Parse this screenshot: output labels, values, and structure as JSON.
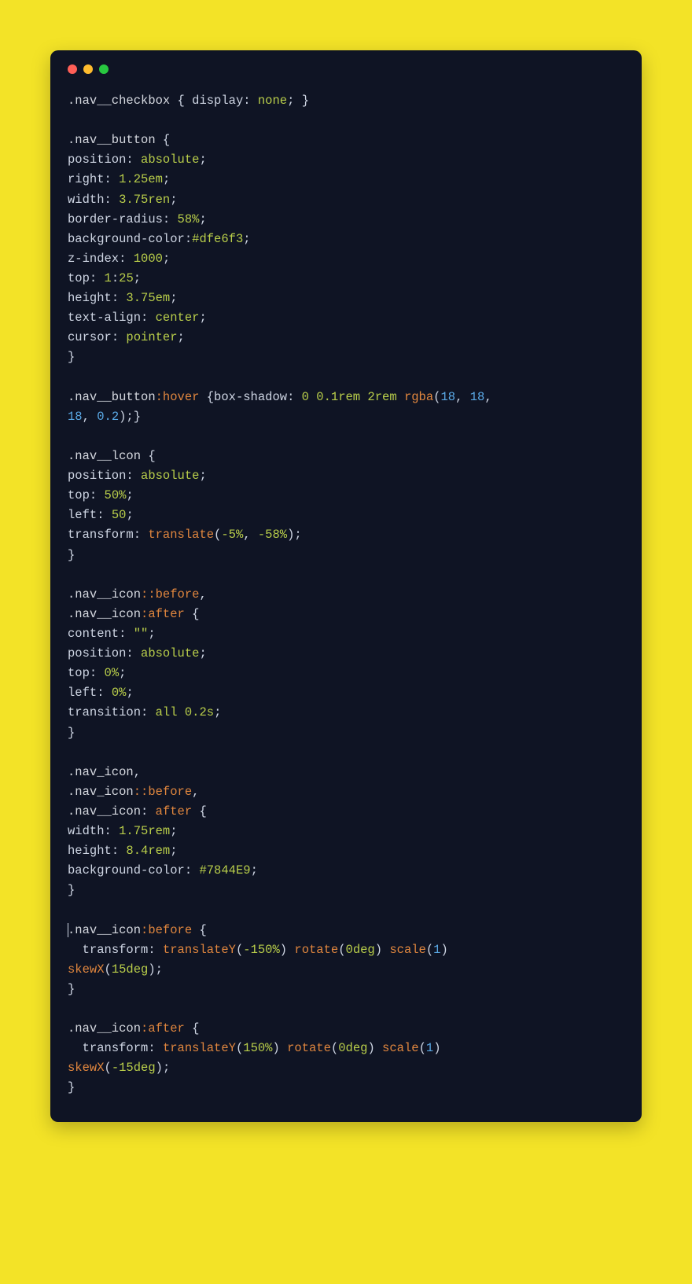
{
  "colors": {
    "close": "#ff5f57",
    "minimize": "#febc2e",
    "zoom": "#28c840"
  },
  "code": {
    "l1_sel": ".nav__checkbox",
    "l1_open": " { ",
    "l1_prop": "display",
    "l1_colon": ": ",
    "l1_val": "none",
    "l1_close": "; }",
    "l3_sel": ".nav__button",
    "l3_open": " {",
    "l4_prop": "position",
    "l4_val": "absolute",
    "l5_prop": "right",
    "l5_val": "1.25em",
    "l6_prop": "width",
    "l6_val": "3.75ren",
    "l7_prop": "border-radius",
    "l7_val": "58%",
    "l8_prop": "background-color",
    "l8_val": "#dfe6f3",
    "l9_prop": "z-index",
    "l9_val": "1000",
    "l10_prop": "top",
    "l10_val": "1",
    "l10_colon2": ":",
    "l10_val2": "25",
    "l11_prop": "height",
    "l11_val": "3.75em",
    "l12_prop": "text-align",
    "l12_val": "center",
    "l13_prop": "cursor",
    "l13_val": "pointer",
    "l14_close": "}",
    "l16_sel": ".nav__button",
    "l16_pseudo": ":hover",
    "l16_open": " {",
    "l16_prop": "box-shadow",
    "l16_colon": ": ",
    "l16_v1": "0",
    "l16_sp1": " ",
    "l16_v2": "0.1rem",
    "l16_sp2": " ",
    "l16_v3": "2rem",
    "l16_sp3": " ",
    "l16_func": "rgba",
    "l16_paren": "(",
    "l16_n1": "18",
    "l16_c1": ", ",
    "l16_n2": "18",
    "l16_c2": ",",
    "l17_n3": "18",
    "l17_c3": ", ",
    "l17_n4": "0.2",
    "l17_close": ");}",
    "l19_sel": ".nav__lcon",
    "l19_open": " {",
    "l20_prop": "position",
    "l20_val": "absolute",
    "l21_prop": "top",
    "l21_val": "50%",
    "l22_prop": "left",
    "l22_val": "50",
    "l23_prop": "transform",
    "l23_colon": ": ",
    "l23_func": "translate",
    "l23_paren": "(",
    "l23_a1": "-5%",
    "l23_c": ", ",
    "l23_a2": "-58%",
    "l23_close": ");",
    "l24_close": "}",
    "l26_sel": ".nav__icon",
    "l26_pseudo": "::before",
    "l26_comma": ",",
    "l27_sel": ".nav__icon",
    "l27_pseudo": ":after",
    "l27_open": " {",
    "l28_prop": "content",
    "l28_val": "\"\"",
    "l29_prop": "position",
    "l29_val": "absolute",
    "l30_prop": "top",
    "l30_val": "0%",
    "l31_prop": "left",
    "l31_val": "0%",
    "l32_prop": "transition",
    "l32_val1": "all",
    "l32_sp": " ",
    "l32_val2": "0.2s",
    "l33_close": "}",
    "l35_sel": ".nav_icon",
    "l35_comma": ",",
    "l36_sel": ".nav_icon",
    "l36_pseudo": "::before",
    "l36_comma": ",",
    "l37_sel": ".nav__icon",
    "l37_colon": ":",
    "l37_sp": " ",
    "l37_pseudo": "after",
    "l37_open": " {",
    "l38_prop": "width",
    "l38_val": "1.75rem",
    "l39_prop": "height",
    "l39_val": "8.4rem",
    "l40_prop": "background-color",
    "l40_val": "#7844E9",
    "l41_close": "}",
    "l43_sel": ".nav__icon",
    "l43_pseudo": ":before",
    "l43_open": " {",
    "l44_indent": "  ",
    "l44_prop": "transform",
    "l44_colon": ": ",
    "l44_f1": "translateY",
    "l44_p1": "(",
    "l44_a1": "-150%",
    "l44_p1c": ") ",
    "l44_f2": "rotate",
    "l44_p2": "(",
    "l44_a2": "0deg",
    "l44_p2c": ") ",
    "l44_f3": "scale",
    "l44_p3": "(",
    "l44_a3": "1",
    "l44_p3c": ")",
    "l45_f4": "skewX",
    "l45_p4": "(",
    "l45_a4": "15deg",
    "l45_close": ");",
    "l46_close": "}",
    "l48_sel": ".nav__icon",
    "l48_pseudo": ":after",
    "l48_open": " {",
    "l49_indent": "  ",
    "l49_prop": "transform",
    "l49_colon": ": ",
    "l49_f1": "translateY",
    "l49_p1": "(",
    "l49_a1": "150%",
    "l49_p1c": ") ",
    "l49_f2": "rotate",
    "l49_p2": "(",
    "l49_a2": "0deg",
    "l49_p2c": ") ",
    "l49_f3": "scale",
    "l49_p3": "(",
    "l49_a3": "1",
    "l49_p3c": ")",
    "l50_f4": "skewX",
    "l50_p4": "(",
    "l50_a4": "-15deg",
    "l50_close": ");",
    "l51_close": "}"
  }
}
